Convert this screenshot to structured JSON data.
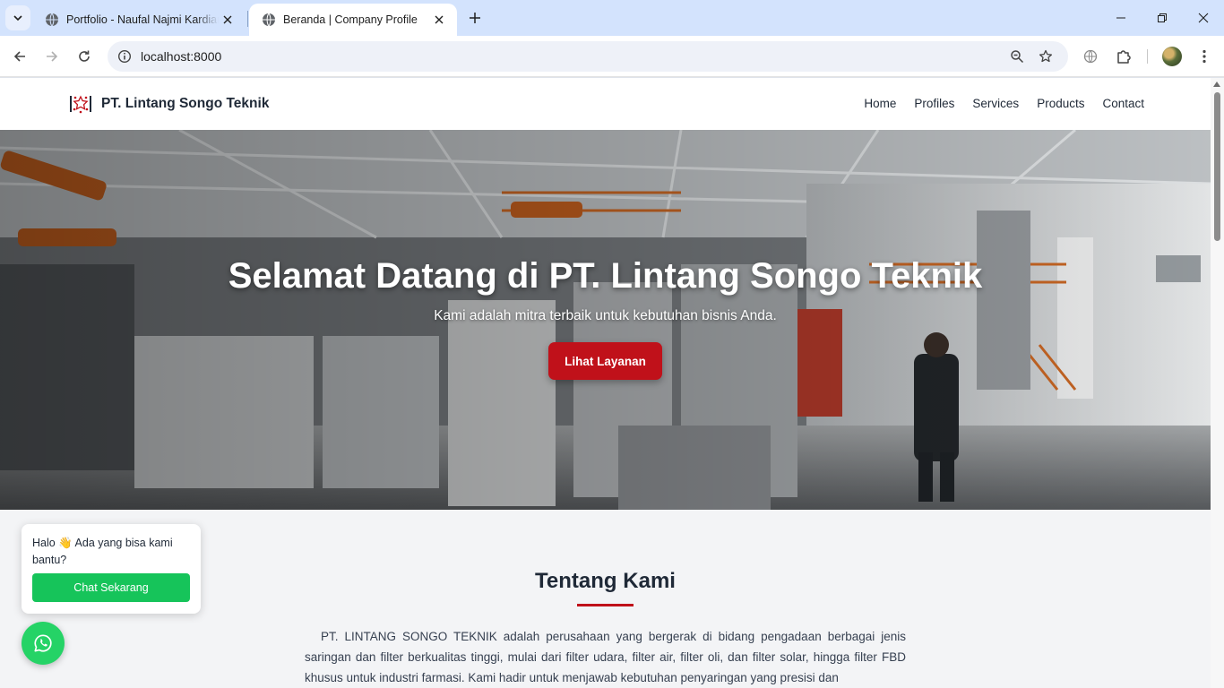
{
  "browser": {
    "tabs": [
      {
        "title": "Portfolio - Naufal Najmi Kardiansyah",
        "active": false
      },
      {
        "title": "Beranda | Company Profile",
        "active": true
      }
    ],
    "url": "localhost:8000"
  },
  "site": {
    "brand": "PT. Lintang Songo Teknik",
    "nav": [
      "Home",
      "Profiles",
      "Services",
      "Products",
      "Contact"
    ],
    "accent_color": "#c0111a"
  },
  "hero": {
    "title": "Selamat Datang di PT. Lintang Songo Teknik",
    "subtitle": "Kami adalah mitra terbaik untuk kebutuhan bisnis Anda.",
    "cta": "Lihat Layanan"
  },
  "about": {
    "title": "Tentang Kami",
    "text": "PT. LINTANG SONGO TEKNIK adalah perusahaan yang bergerak di bidang pengadaan berbagai jenis saringan dan filter berkualitas tinggi, mulai dari filter udara, filter air, filter oli, dan filter solar, hingga filter FBD khusus untuk industri farmasi. Kami hadir untuk menjawab kebutuhan penyaringan yang presisi dan"
  },
  "chat_widget": {
    "message": "Halo 👋 Ada yang bisa kami bantu?",
    "button": "Chat Sekarang",
    "icon": "whatsapp-icon",
    "color": "#25d366"
  }
}
